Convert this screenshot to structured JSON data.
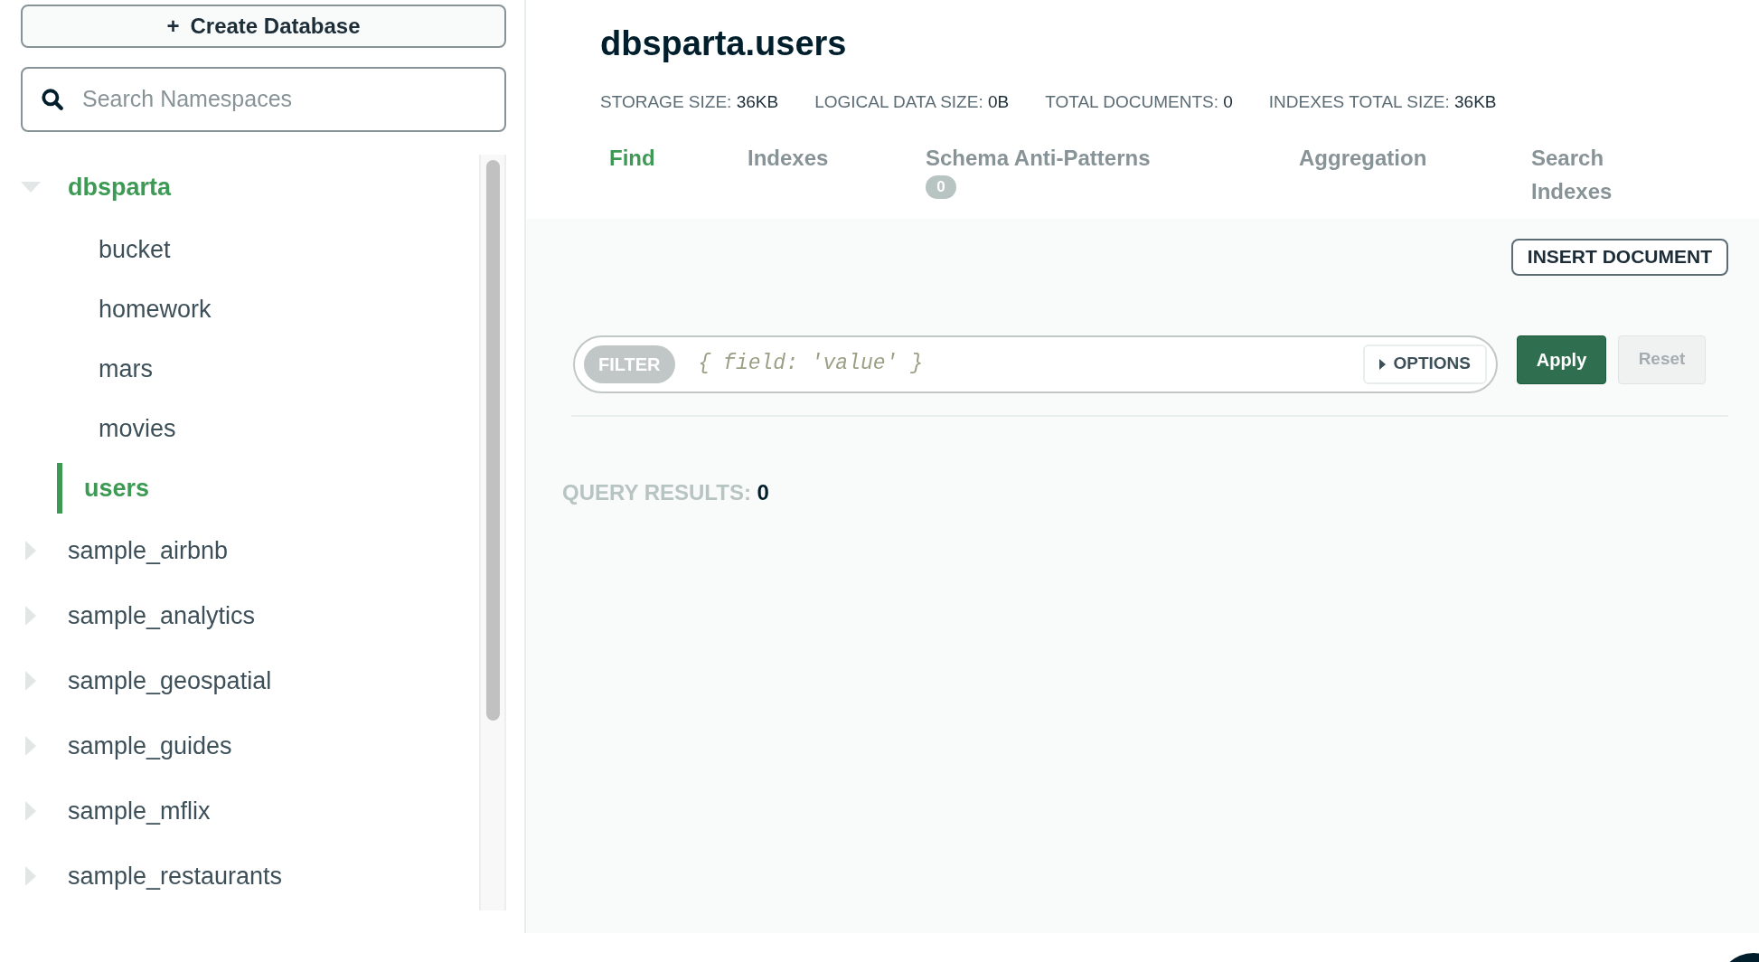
{
  "sidebar": {
    "create_button": {
      "icon": "+",
      "label": "Create Database"
    },
    "search": {
      "placeholder": "Search Namespaces"
    },
    "databases": [
      {
        "name": "dbsparta",
        "expanded": true,
        "selected": true,
        "children": [
          {
            "name": "bucket",
            "selected": false
          },
          {
            "name": "homework",
            "selected": false
          },
          {
            "name": "mars",
            "selected": false
          },
          {
            "name": "movies",
            "selected": false
          },
          {
            "name": "users",
            "selected": true
          }
        ]
      },
      {
        "name": "sample_airbnb",
        "expanded": false,
        "selected": false
      },
      {
        "name": "sample_analytics",
        "expanded": false,
        "selected": false
      },
      {
        "name": "sample_geospatial",
        "expanded": false,
        "selected": false
      },
      {
        "name": "sample_guides",
        "expanded": false,
        "selected": false
      },
      {
        "name": "sample_mflix",
        "expanded": false,
        "selected": false
      },
      {
        "name": "sample_restaurants",
        "expanded": false,
        "selected": false
      }
    ]
  },
  "collection": {
    "title": "dbsparta.users",
    "stats": [
      {
        "label": "STORAGE SIZE:",
        "value": "36KB"
      },
      {
        "label": "LOGICAL DATA SIZE:",
        "value": "0B"
      },
      {
        "label": "TOTAL DOCUMENTS:",
        "value": "0"
      },
      {
        "label": "INDEXES TOTAL SIZE:",
        "value": "36KB"
      }
    ]
  },
  "tabs": [
    {
      "label": "Find",
      "selected": true
    },
    {
      "label": "Indexes",
      "selected": false
    },
    {
      "label": "Schema Anti-Patterns",
      "badge": "0",
      "selected": false
    },
    {
      "label": "Aggregation",
      "selected": false
    },
    {
      "label": "Search Indexes",
      "selected": false
    }
  ],
  "toolbar": {
    "insert_button": "INSERT DOCUMENT"
  },
  "query": {
    "filter_label": "FILTER",
    "placeholder": "{ field: 'value' }",
    "options_button": "OPTIONS",
    "apply_button": "Apply",
    "reset_button": "Reset",
    "reset_disabled": true
  },
  "results": {
    "label": "QUERY RESULTS:",
    "count": "0"
  }
}
